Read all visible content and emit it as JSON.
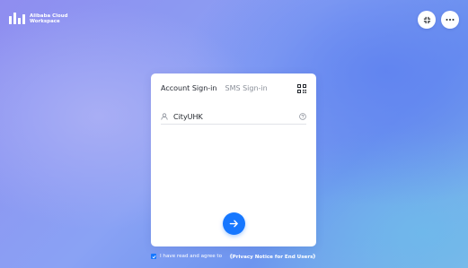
{
  "brand": {
    "line1": "Alibaba Cloud",
    "line2": "Workspace"
  },
  "header": {
    "expand_icon": "fullscreen-icon",
    "more_icon": "more-horizontal-icon"
  },
  "signin": {
    "tabs": [
      {
        "label": "Account Sign-in",
        "active": true
      },
      {
        "label": "SMS Sign-in",
        "active": false
      }
    ],
    "qr_icon": "qr-code-icon",
    "account_value": "CityUHK",
    "submit_icon": "arrow-right-icon"
  },
  "agreement": {
    "checked": true,
    "text": "I have read and agree to",
    "link": "《Privacy Notice for End Users》"
  },
  "colors": {
    "accent": "#1677ff"
  }
}
